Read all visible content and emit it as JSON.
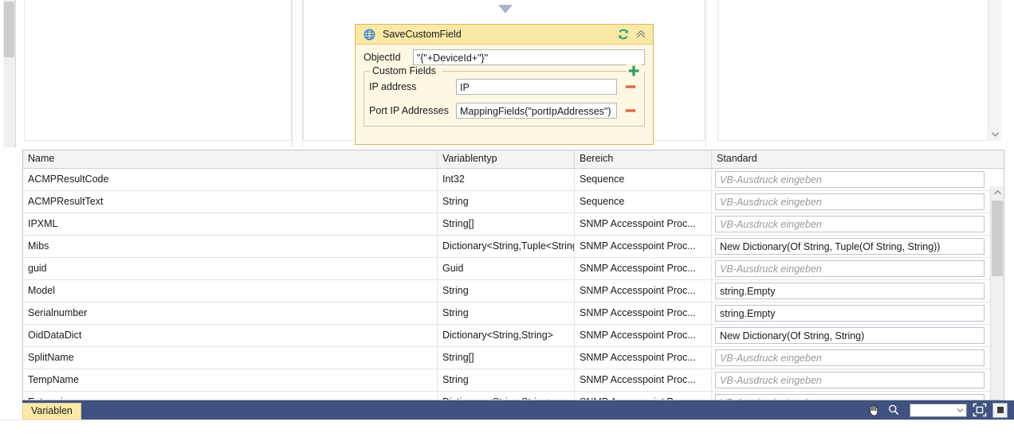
{
  "designer": {
    "connector_icon": "triangle-down-icon",
    "activity": {
      "icon": "globe-icon",
      "title": "SaveCustomField",
      "refresh_icon": "refresh-icon",
      "collapse_icon": "chevron-double-up-icon",
      "objectid_label": "ObjectId",
      "objectid_value": "\"{\"+DeviceId+\"}\"",
      "group_legend": "Custom Fields",
      "add_icon": "plus-icon",
      "remove_icon": "minus-icon",
      "custom_fields": [
        {
          "label": "IP address",
          "value": "IP"
        },
        {
          "label": "Port IP Addresses",
          "value": "MappingFields(\"portIpAddresses\")"
        }
      ]
    }
  },
  "grid": {
    "columns": [
      "Name",
      "Variablentyp",
      "Bereich",
      "Standard"
    ],
    "default_placeholder": "VB-Ausdruck eingeben",
    "rows": [
      {
        "name": "ACMPResultCode",
        "type": "Int32",
        "scope": "Sequence",
        "default": "",
        "is_placeholder": true
      },
      {
        "name": "ACMPResultText",
        "type": "String",
        "scope": "Sequence",
        "default": "",
        "is_placeholder": true
      },
      {
        "name": "IPXML",
        "type": "String[]",
        "scope": "SNMP Accesspoint Proc...",
        "default": "",
        "is_placeholder": true
      },
      {
        "name": "Mibs",
        "type": "Dictionary<String,Tuple<String,String>>",
        "scope": "SNMP Accesspoint Proc...",
        "default": "New Dictionary(Of String, Tuple(Of String, String))",
        "is_placeholder": false
      },
      {
        "name": "guid",
        "type": "Guid",
        "scope": "SNMP Accesspoint Proc...",
        "default": "",
        "is_placeholder": true
      },
      {
        "name": "Model",
        "type": "String",
        "scope": "SNMP Accesspoint Proc...",
        "default": "string.Empty",
        "is_placeholder": false
      },
      {
        "name": "Serialnumber",
        "type": "String",
        "scope": "SNMP Accesspoint Proc...",
        "default": "string.Empty",
        "is_placeholder": false
      },
      {
        "name": "OidDataDict",
        "type": "Dictionary<String,String>",
        "scope": "SNMP Accesspoint Proc...",
        "default": "New Dictionary(Of String, String)",
        "is_placeholder": false
      },
      {
        "name": "SplitName",
        "type": "String[]",
        "scope": "SNMP Accesspoint Proc...",
        "default": "",
        "is_placeholder": true
      },
      {
        "name": "TempName",
        "type": "String",
        "scope": "SNMP Accesspoint Proc...",
        "default": "",
        "is_placeholder": true
      },
      {
        "name": "Enterprises",
        "type": "Dictionary<String,String>",
        "scope": "SNMP Accesspoint Proc...",
        "default": "",
        "is_placeholder": true
      }
    ]
  },
  "statusbar": {
    "tab_label": "Variablen",
    "pan_icon": "hand-icon",
    "zoom_icon": "magnifier-icon",
    "zoom_value": "",
    "fit_to_screen_icon": "fit-to-screen-icon",
    "actual_size_icon": "actual-size-icon"
  },
  "colors": {
    "activity_header": "#fbe9a8",
    "activity_body": "#fdf7e3",
    "activity_border": "#d9b65a",
    "statusbar": "#3f5280",
    "globe": "#2d7dd2",
    "refresh": "#22a06b",
    "plus": "#2e9e5b",
    "minus": "#e2603b"
  }
}
